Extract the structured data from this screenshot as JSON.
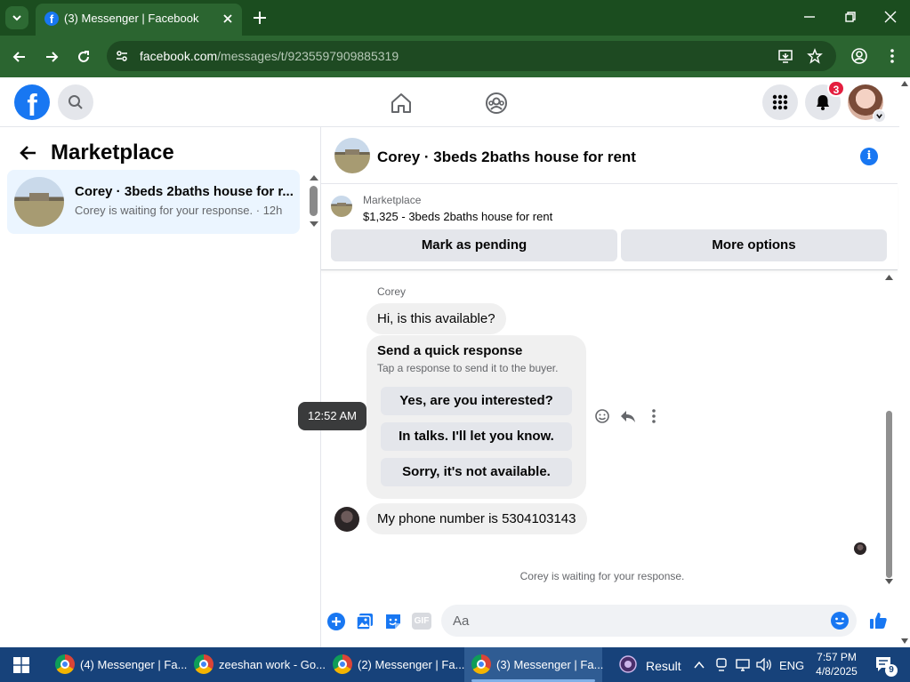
{
  "browser": {
    "tab_title": "(3) Messenger | Facebook",
    "url_host": "facebook.com",
    "url_path": "/messages/t/9235597909885319"
  },
  "fb_header": {
    "notification_count": "3"
  },
  "left_panel": {
    "title": "Marketplace",
    "conversation": {
      "name": "Corey · 3beds 2baths house for r...",
      "preview": "Corey is waiting for your response. · 12h"
    }
  },
  "chat": {
    "header_name": "Corey · 3beds 2baths house for rent",
    "listing": {
      "source": "Marketplace",
      "price_title": "$1,325 - 3beds 2baths house for rent"
    },
    "buttons": {
      "mark_pending": "Mark as pending",
      "more_options": "More options"
    },
    "sender_name": "Corey",
    "messages": [
      "Hi, is this available?",
      "My phone number is 5304103143"
    ],
    "quick_response": {
      "title": "Send a quick response",
      "subtitle": "Tap a response to send it to the buyer.",
      "options": [
        "Yes, are you interested?",
        "In talks. I'll let you know.",
        "Sorry, it's not available."
      ]
    },
    "timestamp": "12:52 AM",
    "waiting_text": "Corey is waiting for your response.",
    "composer_placeholder": "Aa",
    "gif_label": "GIF"
  },
  "taskbar": {
    "items": [
      "(4) Messenger | Fa...",
      "zeeshan work - Go...",
      "(2) Messenger | Fa...",
      "(3) Messenger | Fa..."
    ],
    "result_label": "Result",
    "language": "ENG",
    "time": "7:57 PM",
    "date": "4/8/2025",
    "notification_count": "9"
  },
  "colors": {
    "facebook_blue": "#1877f2",
    "chrome_frame": "#1b4d1f",
    "taskbar": "#17427a"
  }
}
